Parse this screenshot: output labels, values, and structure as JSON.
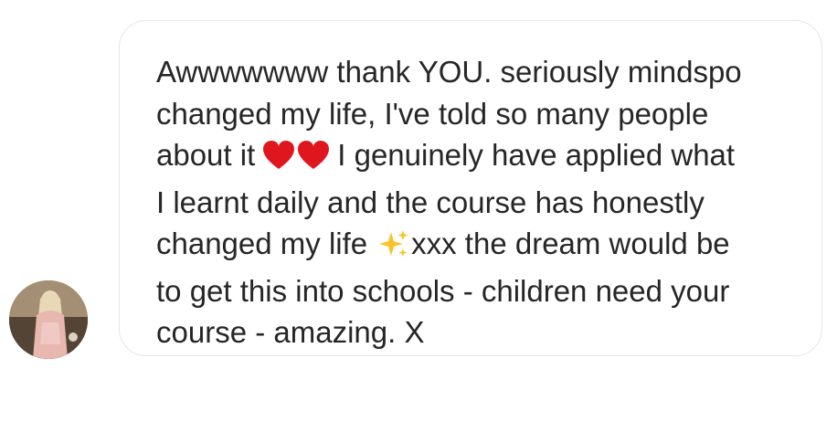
{
  "conversation": {
    "sender": {
      "avatar_icon": "profile-photo-avatar"
    },
    "message": {
      "line1": "Awwwwwww thank YOU. seriously mindspo",
      "line2": "changed my life, I've told so many people",
      "line3_before": "about it",
      "line3_emoji": "red-heart-emoji x2",
      "line3_after": "I genuinely have applied what",
      "line4": "I learnt daily and the course has honestly",
      "line5_before": "changed my life",
      "line5_emoji": "sparkles-emoji",
      "line5_after": "xxx the dream would be",
      "line6": "to get this into schools - children need your",
      "line7": "course - amazing. X"
    }
  },
  "colors": {
    "text": "#262626",
    "bubble_border": "#e6e6e6",
    "heart": "#e0161f",
    "sparkle": "#f7c52b",
    "background": "#ffffff"
  }
}
